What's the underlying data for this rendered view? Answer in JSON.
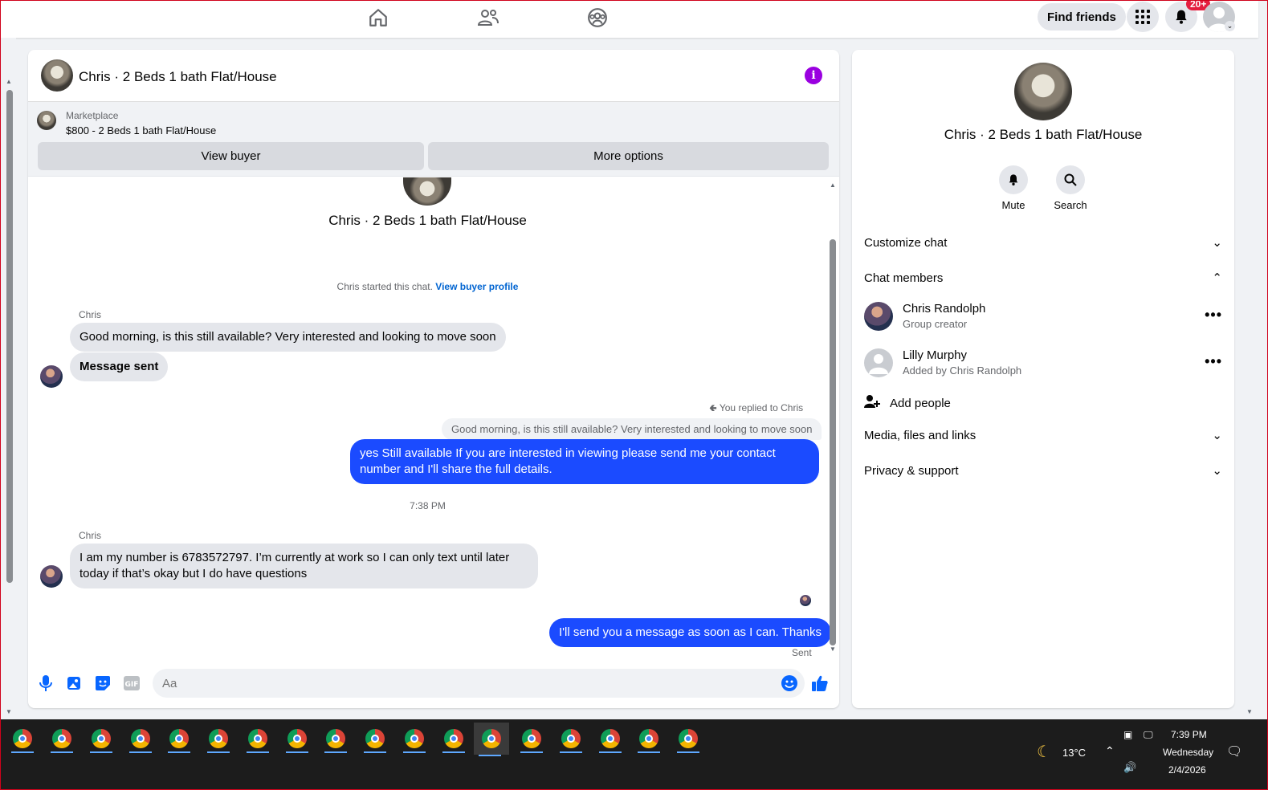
{
  "topnav": {
    "find_friends": "Find friends",
    "notif_badge": "20+"
  },
  "chat": {
    "title": "Chris · 2 Beds 1 bath Flat/House",
    "marketplace_label": "Marketplace",
    "listing": "$800 - 2 Beds 1 bath Flat/House",
    "view_buyer": "View buyer",
    "more_options": "More options",
    "center_name": "Chris · 2 Beds 1 bath Flat/House",
    "started_text": "Chris started this chat.",
    "view_buyer_profile": "View buyer profile",
    "messages": {
      "sender1": "Chris",
      "m1": "Good morning, is this still available? Very interested and looking to move soon",
      "m2": "Message sent",
      "replied_to": "You replied to Chris",
      "reply_preview": "Good morning, is this still available? Very interested and looking to move soon",
      "m3_line1": "yes Still available If you are interested in viewing please send me your contact",
      "m3_line2": "number and I'll share the full details.",
      "time": "7:38 PM",
      "sender2": "Chris",
      "m4_line1": "I am my number is 6783572797. I’m currently at work so I can only text until later",
      "m4_line2": "today if that’s okay but I do have questions",
      "m5": "I'll send you a message as soon as I can. Thanks",
      "status": "Sent"
    },
    "composer_placeholder": "Aa"
  },
  "side": {
    "name": "Chris · 2 Beds 1 bath Flat/House",
    "mute": "Mute",
    "search": "Search",
    "customize": "Customize chat",
    "members_title": "Chat members",
    "members": [
      {
        "name": "Chris Randolph",
        "sub": "Group creator"
      },
      {
        "name": "Lilly Murphy",
        "sub": "Added by Chris Randolph"
      }
    ],
    "add_people": "Add people",
    "media": "Media, files and links",
    "privacy": "Privacy & support"
  },
  "taskbar": {
    "temperature": "13°C",
    "time": "7:39 PM",
    "day": "Wednesday",
    "date": "2/4/2026"
  },
  "colors": {
    "accent": "#0064d1",
    "bubble_out": "#1b4bff",
    "info": "#9a00e0",
    "badge": "#e41e3f"
  }
}
